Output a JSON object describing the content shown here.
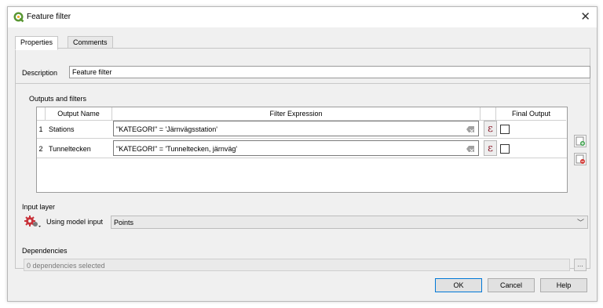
{
  "window": {
    "title": "Feature filter",
    "close_glyph": "✕"
  },
  "tabs": [
    {
      "label": "Properties",
      "active": true
    },
    {
      "label": "Comments",
      "active": false
    }
  ],
  "description": {
    "label": "Description",
    "value": "Feature filter"
  },
  "outputs": {
    "group_label": "Outputs and filters",
    "columns": [
      "Output Name",
      "Filter Expression",
      "Final Output"
    ],
    "rows": [
      {
        "num": "1",
        "name": "Stations",
        "expression": "\"KATEGORI\" = 'Järnvägsstation'",
        "final_output": false
      },
      {
        "num": "2",
        "name": "Tunneltecken",
        "expression": "\"KATEGORI\" = 'Tunneltecken, järnväg'",
        "final_output": false
      }
    ],
    "expression_button_glyph": "ε",
    "add_icon": "add-output-icon",
    "remove_icon": "remove-output-icon"
  },
  "input_layer": {
    "label": "Input layer",
    "mode_label": "Using model input",
    "value": "Points"
  },
  "dependencies": {
    "label": "Dependencies",
    "value": "0 dependencies selected",
    "browse_label": "..."
  },
  "buttons": {
    "ok": "OK",
    "cancel": "Cancel",
    "help": "Help"
  },
  "colors": {
    "qgis_green": "#589632",
    "accent": "#0078d7",
    "epsilon": "#8b1a2a"
  }
}
